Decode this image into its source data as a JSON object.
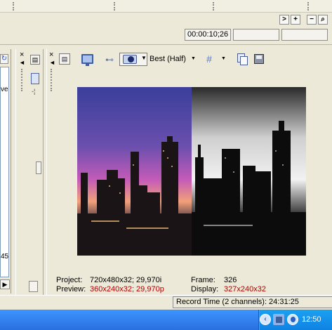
{
  "top_nav": {
    "next_label": ">",
    "plus_label": "+",
    "minus_label": "−",
    "zoom_label": "⌕"
  },
  "timeline": {
    "time_value": "00:00:10;26"
  },
  "left_panel": {
    "fragment_top": "ve",
    "fragment_bottom": "45"
  },
  "preview_toolbar": {
    "quality_label": "Best (Half)"
  },
  "video_info": {
    "project_label": "Project:",
    "project_value": "720x480x32; 29,970i",
    "preview_label": "Preview:",
    "preview_value": "360x240x32; 29,970p",
    "frame_label": "Frame:",
    "frame_value": "326",
    "display_label": "Display:",
    "display_value": "327x240x32"
  },
  "status": {
    "record_time": "Record Time (2 channels): 24:31:25"
  },
  "taskbar": {
    "clock": "12:50"
  },
  "colors": {
    "accent_red": "#b00000",
    "taskbar_blue": "#2a6fe0",
    "tray_blue": "#0f82e3"
  },
  "icons": [
    "refresh-icon",
    "close-icon",
    "import-icon",
    "monitor-icon",
    "split-icon",
    "quality-icon",
    "grid-icon",
    "copy-icon",
    "save-icon",
    "volume-icon",
    "network-icon",
    "security-icon"
  ]
}
